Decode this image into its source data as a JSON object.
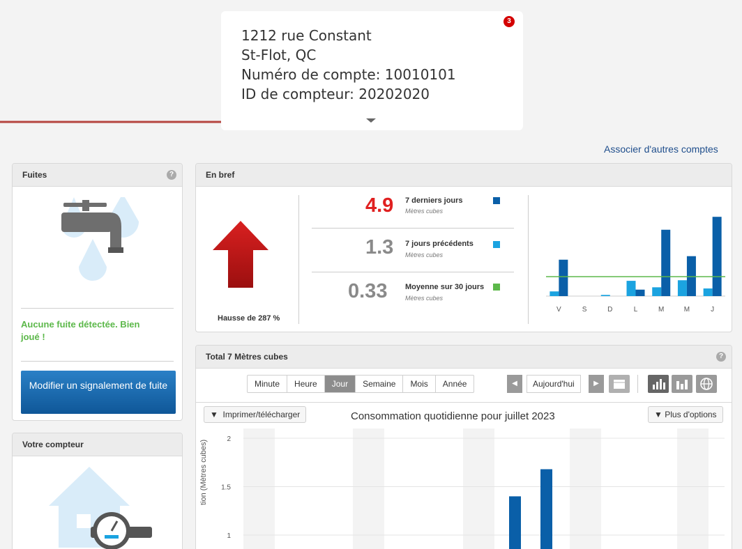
{
  "account": {
    "address_line1": "1212 rue Constant",
    "address_line2": "St-Flot, QC",
    "account_number": "Numéro de compte: 10010101",
    "meter_id": "ID de compteur: 20202020",
    "notification_count": "3"
  },
  "link_other_accounts": "Associer d'autres comptes",
  "leaks_panel": {
    "title": "Fuites",
    "help": "?",
    "status": "Aucune fuite détectée. Bien joué !",
    "button_label": "Modifier un signalement de fuite"
  },
  "meter_panel": {
    "title": "Votre compteur"
  },
  "summary_panel": {
    "title": "En bref",
    "trend_label": "Hausse de 287 %",
    "kpis": [
      {
        "value": "4.9",
        "label": "7 derniers jours",
        "unit": "Mètres cubes",
        "color": "#e02020",
        "swatch": "#0a5fa8"
      },
      {
        "value": "1.3",
        "label": "7 jours précédents",
        "unit": "Mètres cubes",
        "color": "#8a8a8a",
        "swatch": "#1ba3e0"
      },
      {
        "value": "0.33",
        "label": "Moyenne sur 30 jours",
        "unit": "Mètres cubes",
        "color": "#8a8a8a",
        "swatch": "#5cb84a"
      }
    ]
  },
  "total_panel": {
    "title": "Total 7 Mètres cubes",
    "help": "?",
    "periods": [
      "Minute",
      "Heure",
      "Jour",
      "Semaine",
      "Mois",
      "Année"
    ],
    "active_period": "Jour",
    "today_label": "Aujourd'hui",
    "print_label": "Imprimer/télécharger",
    "chart_title": "Consommation quotidienne pour juillet 2023",
    "more_options": "Plus d'options",
    "y_axis_label_visible": "tion (Mètres cubes)"
  },
  "chart_data": [
    {
      "type": "bar",
      "categories": [
        "V",
        "S",
        "D",
        "L",
        "M",
        "M",
        "J"
      ],
      "series": [
        {
          "name": "7 jours précédents",
          "values": [
            0.08,
            0,
            0.02,
            0.26,
            0.15,
            0.27,
            0.13
          ]
        },
        {
          "name": "7 derniers jours",
          "values": [
            0.62,
            0,
            0,
            0.11,
            1.13,
            0.68,
            1.35
          ]
        }
      ],
      "average_line": 0.33,
      "ylim": [
        0,
        1.4
      ],
      "colors": {
        "previous": "#1ba3e0",
        "recent": "#0a5fa8",
        "average": "#5cb84a"
      }
    },
    {
      "type": "bar",
      "title": "Consommation quotidienne pour juillet 2023",
      "ylabel": "Consommation (Mètres cubes)",
      "yticks": [
        "2",
        "1.5",
        "1"
      ],
      "ylim": [
        1,
        2
      ],
      "values": [
        1.4,
        1.68
      ],
      "color": "#0a5fa8"
    }
  ]
}
